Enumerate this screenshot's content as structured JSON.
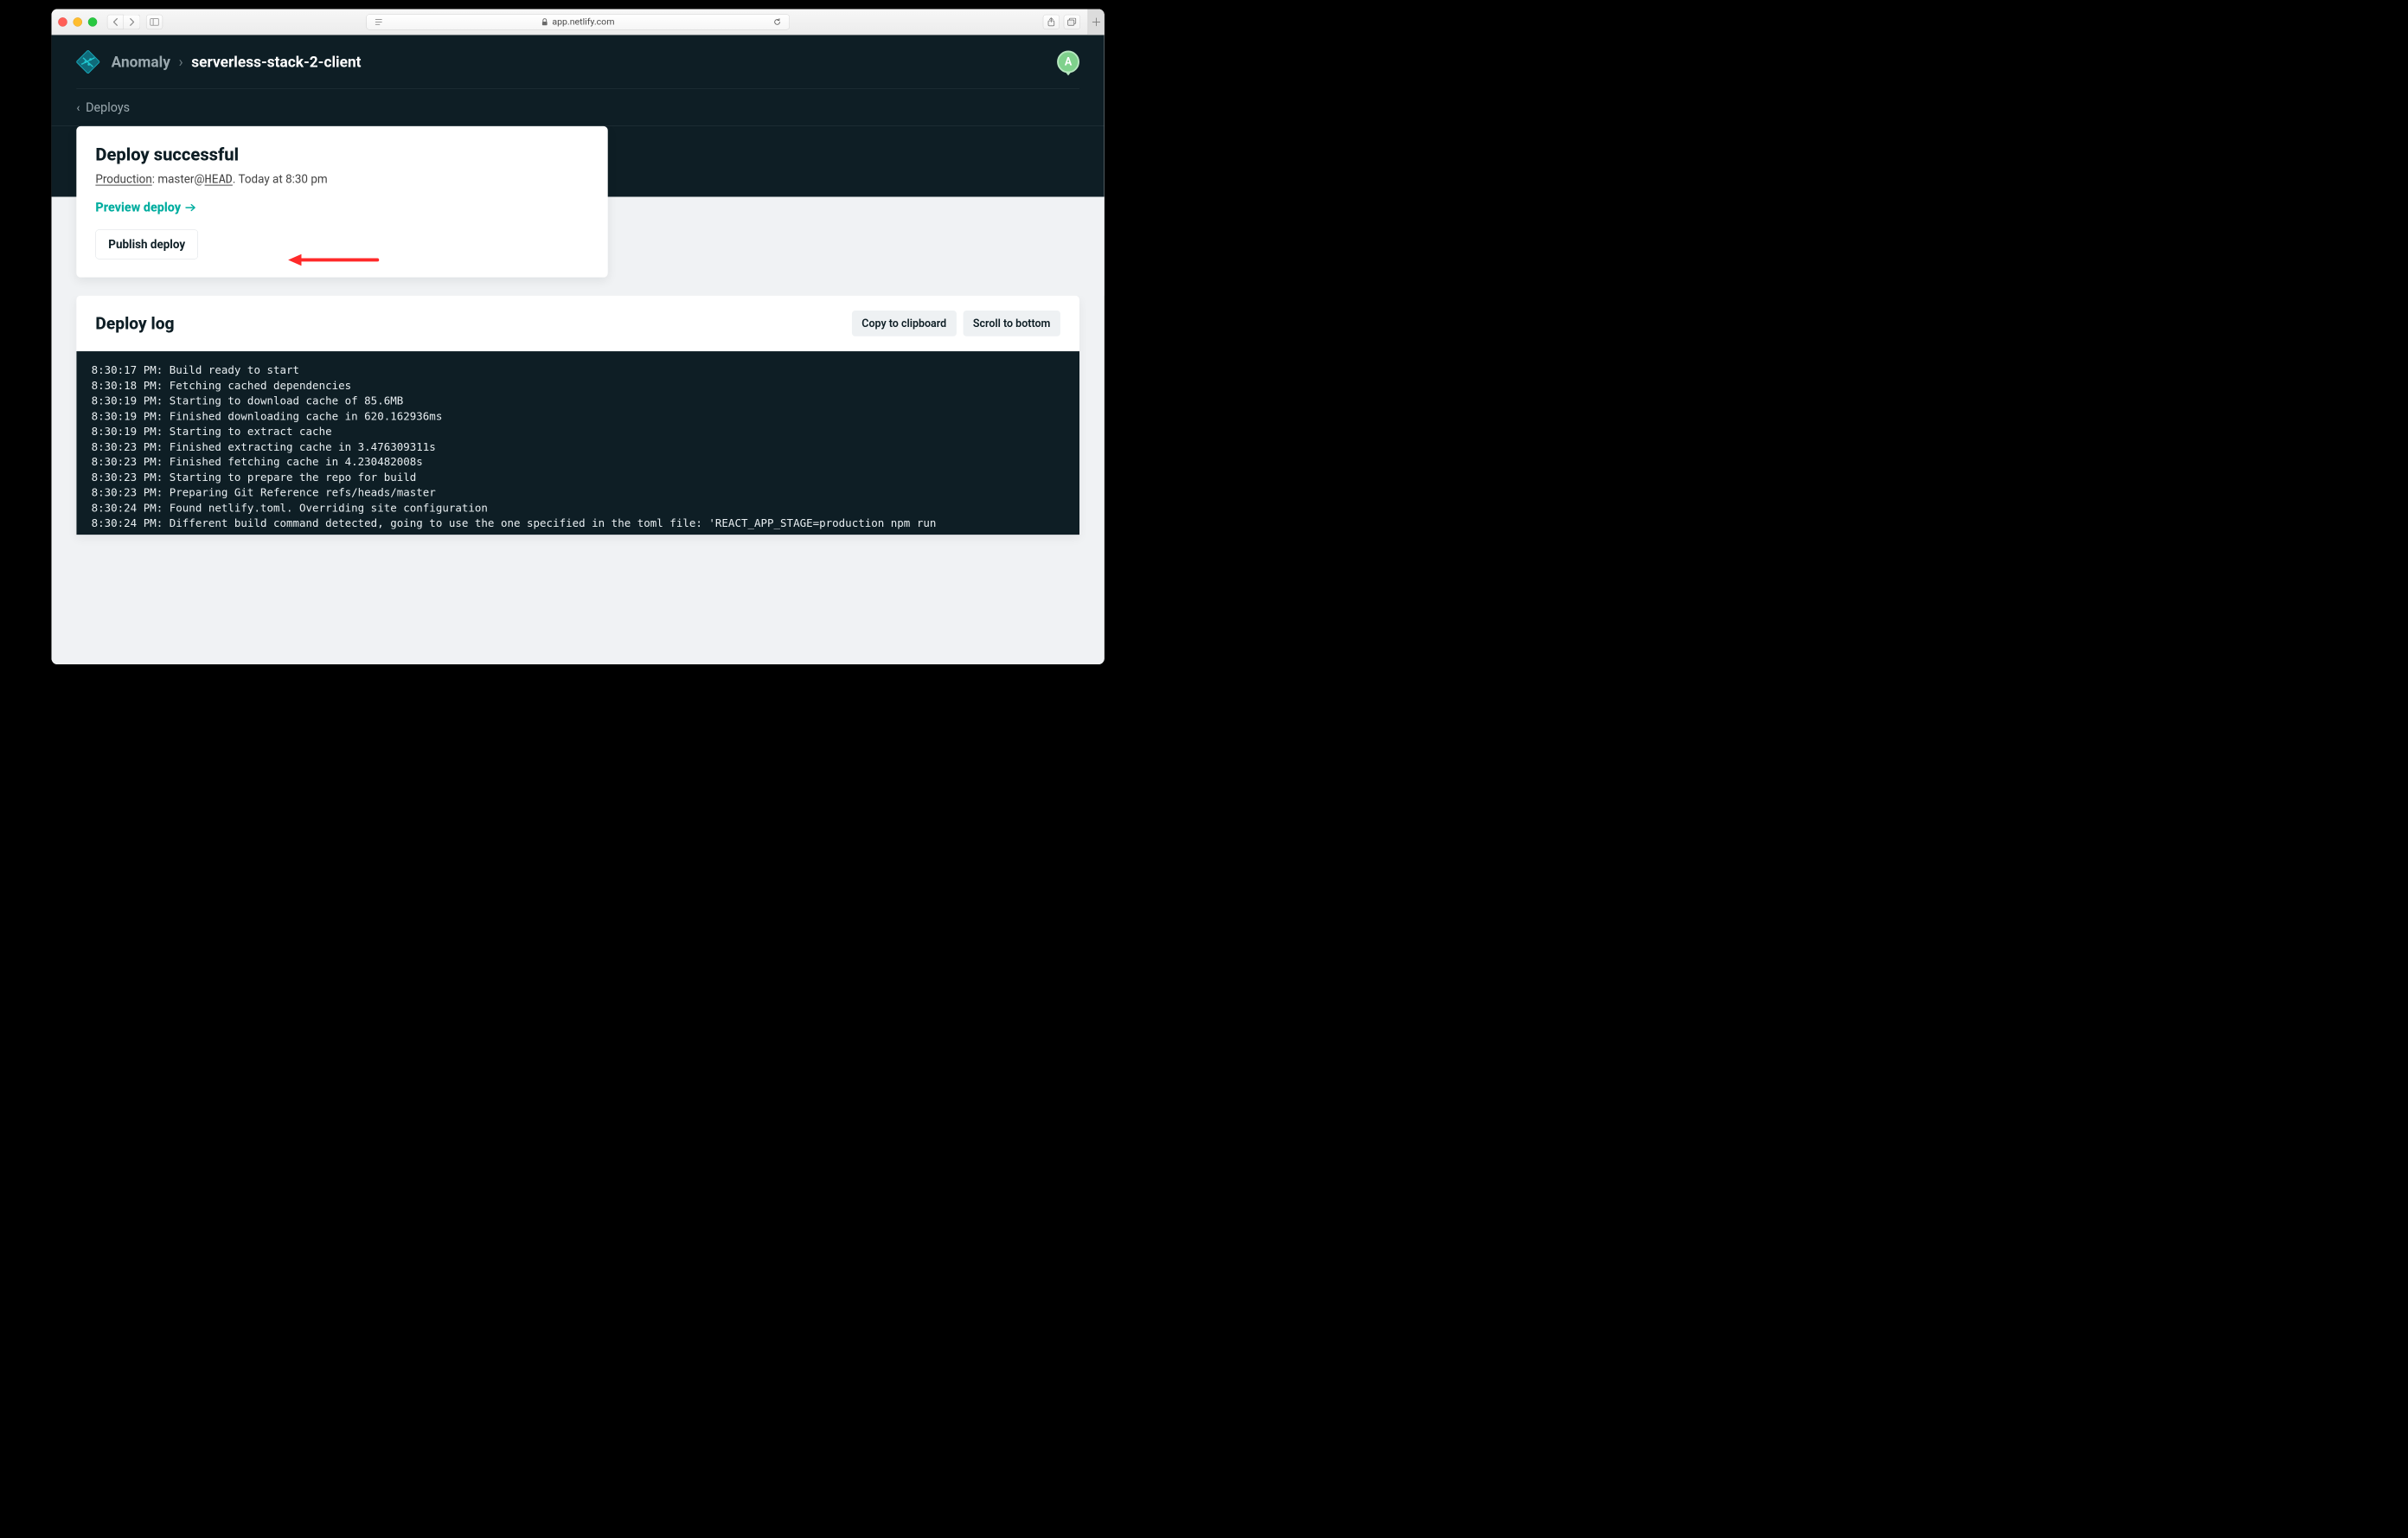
{
  "browser": {
    "url_host": "app.netlify.com"
  },
  "header": {
    "breadcrumb": {
      "parent": "Anomaly",
      "current": "serverless-stack-2-client"
    },
    "avatar_initial": "A"
  },
  "back": {
    "label": "Deploys"
  },
  "deploy_card": {
    "title": "Deploy successful",
    "meta": {
      "env_label": "Production",
      "branch": "master",
      "ref": "HEAD",
      "timestamp": "Today at 8:30 pm"
    },
    "preview_link": "Preview deploy",
    "publish_button": "Publish deploy"
  },
  "log": {
    "title": "Deploy log",
    "copy_button": "Copy to clipboard",
    "scroll_button": "Scroll to bottom",
    "lines": [
      "8:30:17 PM: Build ready to start",
      "8:30:18 PM: Fetching cached dependencies",
      "8:30:19 PM: Starting to download cache of 85.6MB",
      "8:30:19 PM: Finished downloading cache in 620.162936ms",
      "8:30:19 PM: Starting to extract cache",
      "8:30:23 PM: Finished extracting cache in 3.476309311s",
      "8:30:23 PM: Finished fetching cache in 4.230482008s",
      "8:30:23 PM: Starting to prepare the repo for build",
      "8:30:23 PM: Preparing Git Reference refs/heads/master",
      "8:30:24 PM: Found netlify.toml. Overriding site configuration",
      "8:30:24 PM: Different build command detected, going to use the one specified in the toml file: 'REACT_APP_STAGE=production npm run"
    ]
  }
}
